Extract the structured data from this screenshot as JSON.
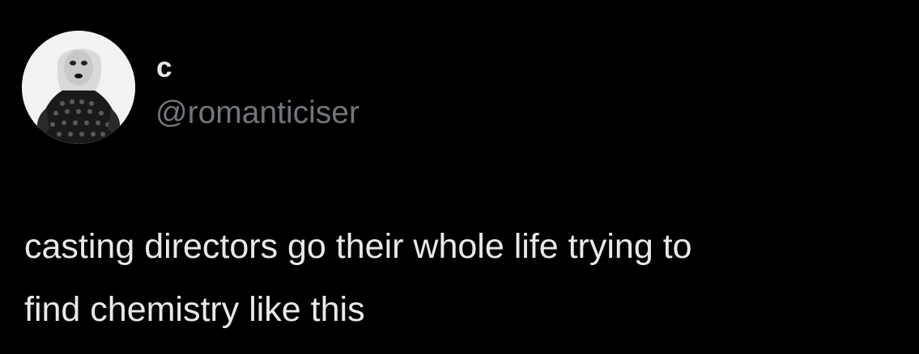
{
  "tweet": {
    "author": {
      "display_name": "c",
      "handle": "@romanticiser",
      "avatar_icon": "profile-avatar-photo"
    },
    "text_lines": [
      "casting directors go their whole life trying to",
      "find chemistry like this"
    ]
  },
  "colors": {
    "background": "#000000",
    "primary_text": "#e7e9ea",
    "secondary_text": "#71767b"
  }
}
